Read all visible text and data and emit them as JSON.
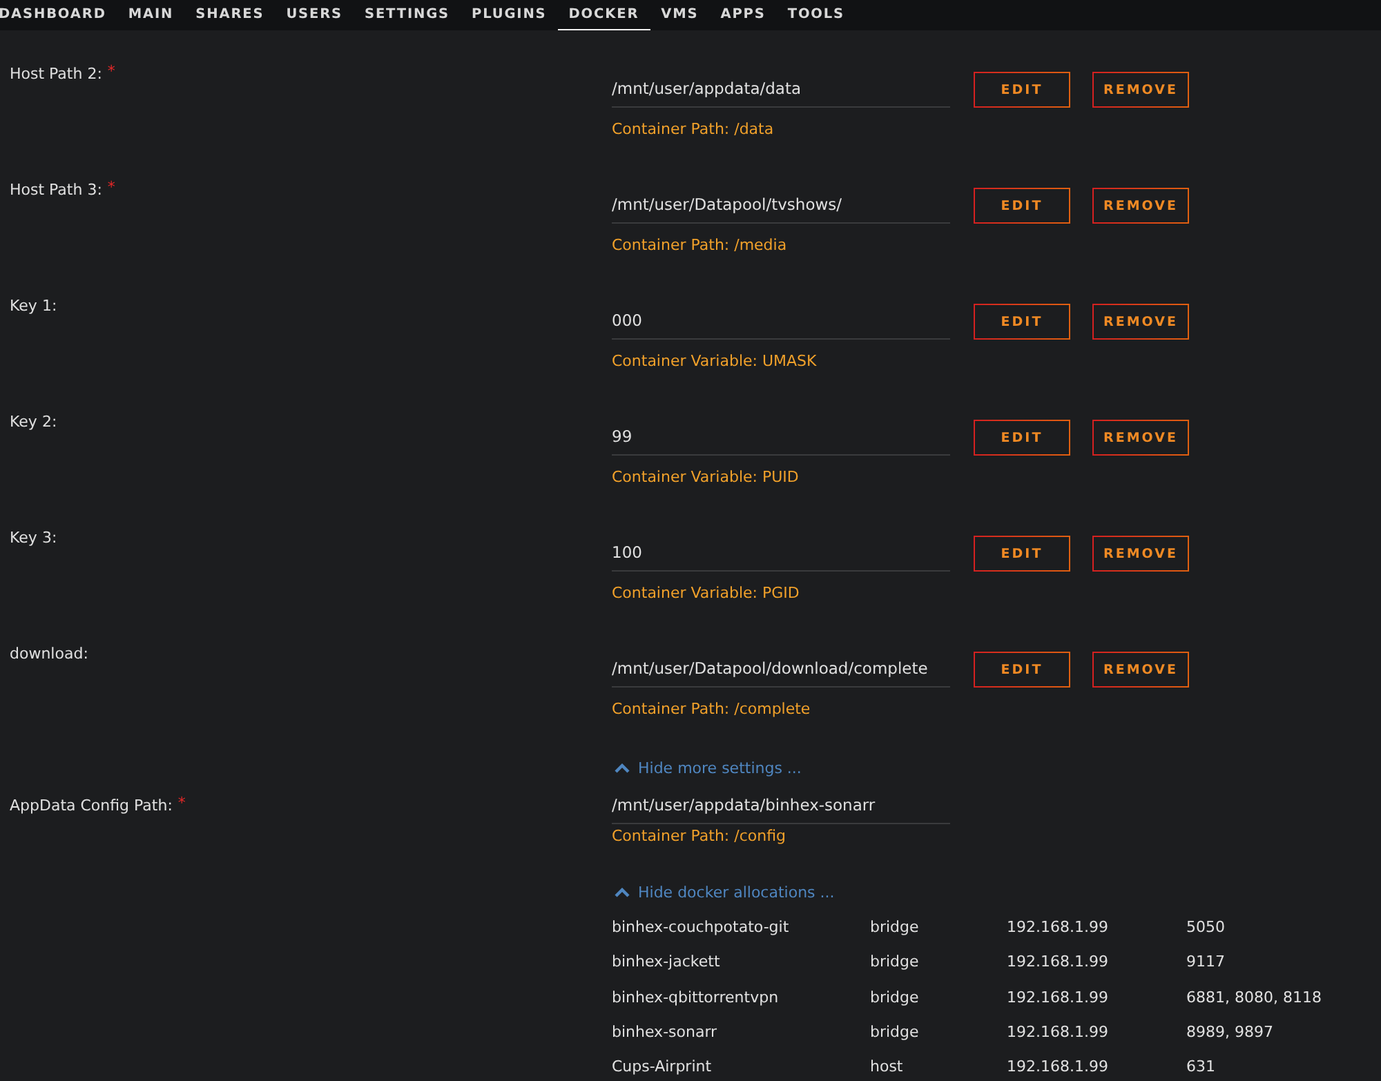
{
  "nav": [
    {
      "label": "DASHBOARD",
      "selected": false
    },
    {
      "label": "MAIN",
      "selected": false
    },
    {
      "label": "SHARES",
      "selected": false
    },
    {
      "label": "USERS",
      "selected": false
    },
    {
      "label": "SETTINGS",
      "selected": false
    },
    {
      "label": "PLUGINS",
      "selected": false
    },
    {
      "label": "DOCKER",
      "selected": true
    },
    {
      "label": "VMS",
      "selected": false
    },
    {
      "label": "APPS",
      "selected": false
    },
    {
      "label": "TOOLS",
      "selected": false
    }
  ],
  "settings": [
    {
      "label": "Host Path 2:",
      "required_mark": "*",
      "value": "/mnt/user/appdata/data",
      "note": "Container Path: /data",
      "buttons": [
        "EDIT",
        "REMOVE"
      ]
    },
    {
      "label": "Host Path 3:",
      "required_mark": "*",
      "value": "/mnt/user/Datapool/tvshows/",
      "note": "Container Path: /media",
      "buttons": [
        "EDIT",
        "REMOVE"
      ]
    },
    {
      "label": "Key 1:",
      "value": "000",
      "note": "Container Variable: UMASK",
      "buttons": [
        "EDIT",
        "REMOVE"
      ]
    },
    {
      "label": "Key 2:",
      "value": "99",
      "note": "Container Variable: PUID",
      "buttons": [
        "EDIT",
        "REMOVE"
      ]
    },
    {
      "label": "Key 3:",
      "value": "100",
      "note": "Container Variable: PGID",
      "buttons": [
        "EDIT",
        "REMOVE"
      ]
    },
    {
      "label": "download:",
      "value": "/mnt/user/Datapool/download/complete",
      "note": "Container Path: /complete",
      "buttons": [
        "EDIT",
        "REMOVE"
      ]
    }
  ],
  "hide_more_link": "Hide more settings ...",
  "appdata": {
    "label": "AppData Config Path:",
    "required_mark": "*",
    "value": "/mnt/user/appdata/binhex-sonarr",
    "note": "Container Path: /config"
  },
  "hide_allocations_link": "Hide docker allocations ...",
  "allocations": [
    {
      "name": "binhex-couchpotato-git",
      "network": "bridge",
      "ip": "192.168.1.99",
      "ports": "5050"
    },
    {
      "name": "binhex-jackett",
      "network": "bridge",
      "ip": "192.168.1.99",
      "ports": "9117"
    },
    {
      "name": "binhex-qbittorrentvpn",
      "network": "bridge",
      "ip": "192.168.1.99",
      "ports": "6881, 8080, 8118"
    },
    {
      "name": "binhex-sonarr",
      "network": "bridge",
      "ip": "192.168.1.99",
      "ports": "8989, 9897"
    },
    {
      "name": "Cups-Airprint",
      "network": "host",
      "ip": "192.168.1.99",
      "ports": "631"
    }
  ]
}
